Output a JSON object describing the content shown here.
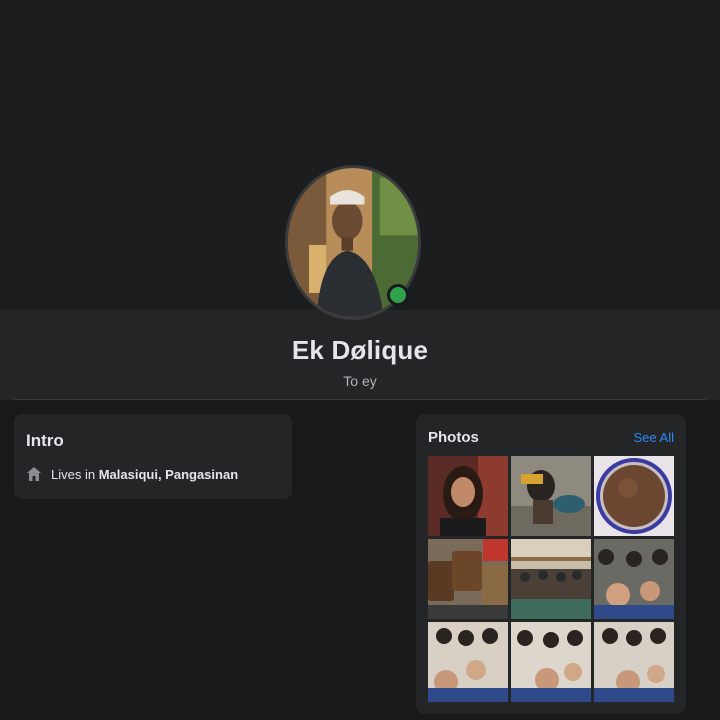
{
  "profile": {
    "name": "Ek Dølique",
    "bio": "To ey",
    "avatar_icon": "profile-photo",
    "online_color": "#31a24c"
  },
  "intro": {
    "title": "Intro",
    "lives_prefix": "Lives in ",
    "location": "Malasiqui, Pangasinan",
    "icon": "home-icon"
  },
  "photos": {
    "title": "Photos",
    "see_all_label": "See All",
    "link_color": "#2d88ff",
    "items": [
      "photo-1",
      "photo-2",
      "photo-3",
      "photo-4",
      "photo-5",
      "photo-6",
      "photo-7",
      "photo-8",
      "photo-9"
    ]
  },
  "theme": {
    "background": "#18191a",
    "card": "#242526",
    "text_primary": "#e4e6eb",
    "text_secondary": "#b0b3b8"
  }
}
